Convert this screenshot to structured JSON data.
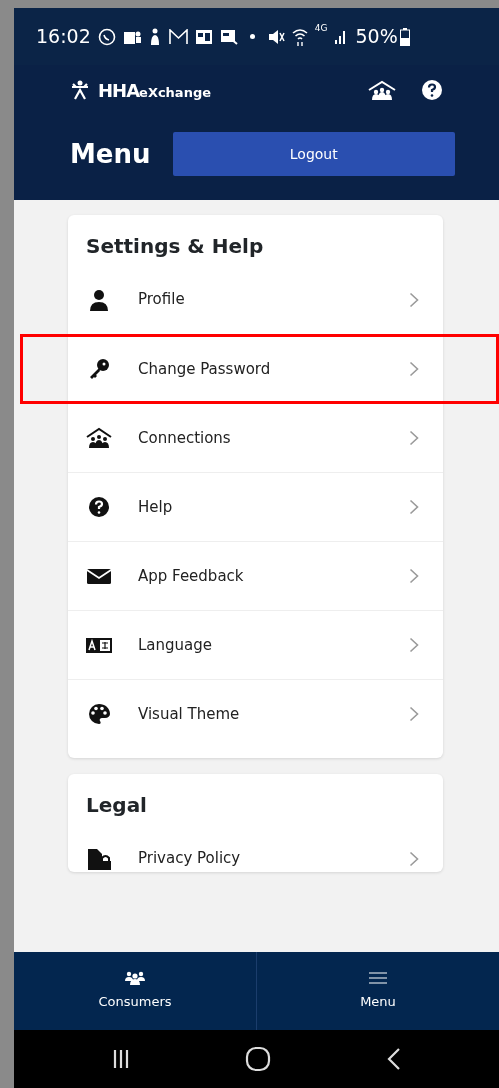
{
  "status_bar": {
    "time": "16:02",
    "network": "4G",
    "battery": "50%"
  },
  "header": {
    "logo_strong": "HHA",
    "logo_rest": "eXchange",
    "title": "Menu",
    "logout": "Logout"
  },
  "sections": [
    {
      "title": "Settings & Help",
      "items": [
        {
          "label": "Profile",
          "highlighted": false
        },
        {
          "label": "Change Password",
          "highlighted": true
        },
        {
          "label": "Connections",
          "highlighted": false
        },
        {
          "label": "Help",
          "highlighted": false
        },
        {
          "label": "App Feedback",
          "highlighted": false
        },
        {
          "label": "Language",
          "highlighted": false
        },
        {
          "label": "Visual Theme",
          "highlighted": false
        }
      ]
    },
    {
      "title": "Legal",
      "items": [
        {
          "label": "Privacy Policy",
          "highlighted": false
        }
      ]
    }
  ],
  "bottom_nav": [
    {
      "label": "Consumers"
    },
    {
      "label": "Menu"
    }
  ]
}
